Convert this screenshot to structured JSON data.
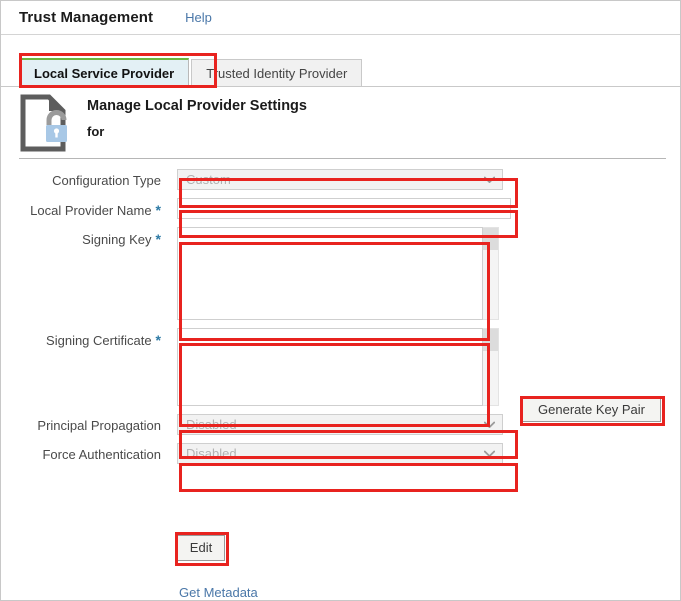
{
  "window": {
    "title": "Trust Management",
    "help_label": "Help"
  },
  "tabs": [
    {
      "label": "Local Service Provider",
      "active": true
    },
    {
      "label": "Trusted Identity Provider",
      "active": false
    }
  ],
  "section": {
    "icon": "document-unlock-icon",
    "title": "Manage Local Provider Settings",
    "subtitle": "for"
  },
  "form": {
    "fields": [
      {
        "id": "configuration-type",
        "label": "Configuration Type",
        "required": false,
        "control": "select",
        "value": "Custom",
        "disabled": true,
        "options": [
          "Custom"
        ]
      },
      {
        "id": "local-provider-name",
        "label": "Local Provider Name",
        "required": true,
        "control": "text",
        "value": "",
        "placeholder": ""
      },
      {
        "id": "signing-key",
        "label": "Signing Key",
        "required": true,
        "control": "textarea",
        "value": "",
        "placeholder": ""
      },
      {
        "id": "signing-certificate",
        "label": "Signing Certificate",
        "required": true,
        "control": "textarea",
        "value": "",
        "placeholder": ""
      },
      {
        "id": "principal-propagation",
        "label": "Principal Propagation",
        "required": false,
        "control": "select",
        "value": "Disabled",
        "disabled": true,
        "options": [
          "Disabled"
        ]
      },
      {
        "id": "force-authentication",
        "label": "Force Authentication",
        "required": false,
        "control": "select",
        "value": "Disabled",
        "disabled": true,
        "options": [
          "Disabled"
        ]
      }
    ],
    "required_marker": "*"
  },
  "actions": {
    "generate_key_pair": "Generate Key Pair",
    "edit": "Edit",
    "get_metadata": "Get Metadata"
  },
  "colors": {
    "annotation": "#e8231f",
    "link": "#4a77a8",
    "required_star": "#2d7aa5",
    "active_tab_bg": "#e3f0f5",
    "active_tab_accent": "#6cb33f",
    "lock_body": "#a8c8e6",
    "doc_outline": "#5d5d5d"
  }
}
